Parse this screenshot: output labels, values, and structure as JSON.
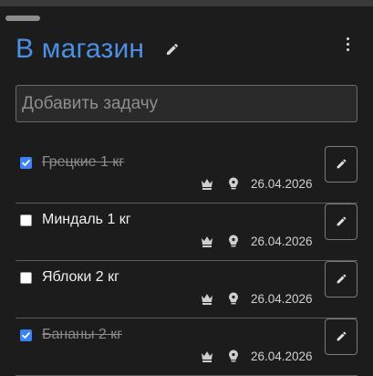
{
  "list": {
    "title": "В магазин",
    "title_edit_icon": "pencil-icon",
    "menu_icon": "more-vertical-icon"
  },
  "new_task": {
    "placeholder": "Добавить задачу",
    "value": ""
  },
  "tasks": [
    {
      "label": "Грецкие 1 кг",
      "done": true,
      "date": "26.04.2026"
    },
    {
      "label": "Миндаль 1 кг",
      "done": false,
      "date": "26.04.2026"
    },
    {
      "label": "Яблоки 2 кг",
      "done": false,
      "date": "26.04.2026"
    },
    {
      "label": "Бананы 2 кг",
      "done": true,
      "date": "26.04.2026"
    }
  ],
  "task_icons": {
    "priority": "crown-icon",
    "idea": "lightbulb-icon",
    "edit": "pencil-icon"
  },
  "colors": {
    "background": "#1c1c1c",
    "title": "#4d8fe3",
    "checkbox_checked": "#3b82f6",
    "done_text": "#8c8c8c"
  }
}
